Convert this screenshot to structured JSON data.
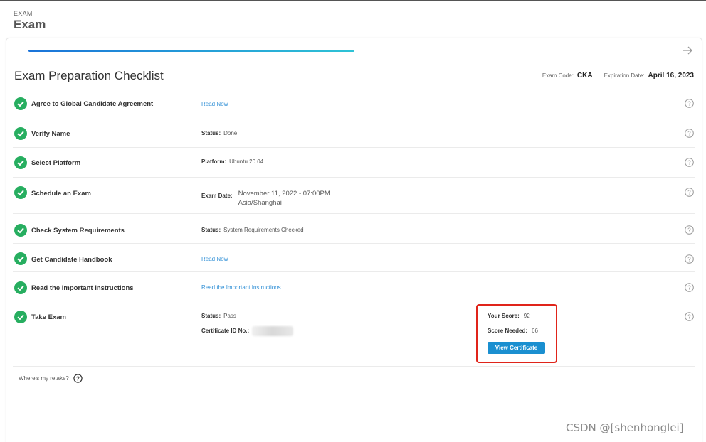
{
  "header": {
    "eyebrow": "EXAM",
    "title": "Exam"
  },
  "card": {
    "progress_fraction": 0.47,
    "checklist_title": "Exam Preparation Checklist",
    "exam_code_label": "Exam Code:",
    "exam_code": "CKA",
    "expiration_label": "Expiration Date:",
    "expiration_date": "April 16, 2023"
  },
  "checklist": [
    {
      "label": "Agree to Global Candidate Agreement",
      "link": "Read Now"
    },
    {
      "label": "Verify Name",
      "status_key": "Status:",
      "status_value": "Done"
    },
    {
      "label": "Select Platform",
      "status_key": "Platform:",
      "status_value": "Ubuntu 20.04"
    },
    {
      "label": "Schedule an Exam",
      "status_key": "Exam Date:",
      "date_line1": "November 11, 2022 - 07:00PM",
      "date_line2": "Asia/Shanghai"
    },
    {
      "label": "Check System Requirements",
      "status_key": "Status:",
      "status_value": "System Requirements Checked"
    },
    {
      "label": "Get Candidate Handbook",
      "link": "Read Now"
    },
    {
      "label": "Read the Important Instructions",
      "link": "Read the Important Instructions"
    },
    {
      "label": "Take Exam",
      "status_key": "Status:",
      "status_value": "Pass",
      "cert_key": "Certificate ID No.:"
    }
  ],
  "score": {
    "your_score_label": "Your Score:",
    "your_score": "92",
    "needed_label": "Score Needed:",
    "needed": "66",
    "button_label": "View Certificate"
  },
  "footer": {
    "retake_text": "Where's my retake?"
  },
  "watermark": "CSDN @[shenhonglei]",
  "colors": {
    "check_green": "#27ae60",
    "link_blue": "#2f8fd6",
    "button_blue": "#1a8fd0",
    "highlight_red": "#e0241a"
  }
}
